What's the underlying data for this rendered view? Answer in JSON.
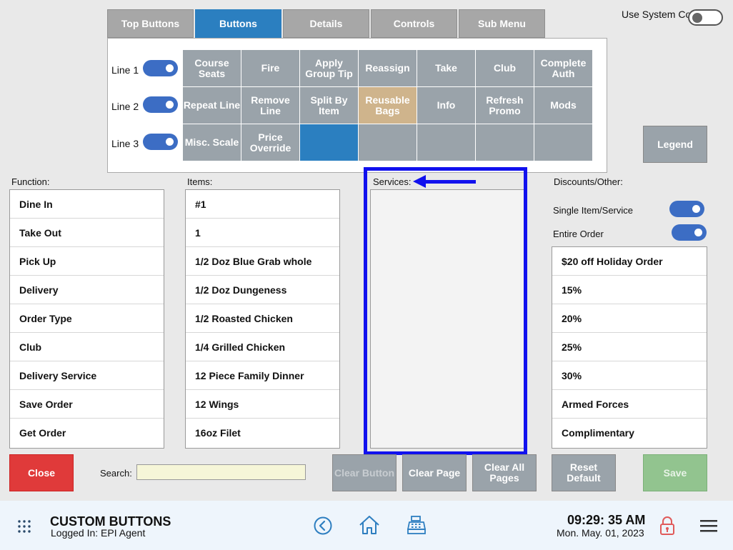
{
  "tabs": [
    "Top Buttons",
    "Buttons",
    "Details",
    "Controls",
    "Sub Menu"
  ],
  "use_system_color": "Use System Color",
  "lines": [
    "Line 1",
    "Line 2",
    "Line 3"
  ],
  "grid": [
    [
      "Course Seats",
      "Fire",
      "Apply Group Tip",
      "Reassign",
      "Take",
      "Club",
      "Complete Auth"
    ],
    [
      "Repeat Line",
      "Remove Line",
      "Split By Item",
      "Reusable Bags",
      "Info",
      "Refresh Promo",
      "Mods"
    ],
    [
      "Misc. Scale",
      "Price Override",
      "",
      "",
      "",
      "",
      ""
    ]
  ],
  "legend": "Legend",
  "labels": {
    "function": "Function:",
    "items": "Items:",
    "services": "Services:",
    "discounts": "Discounts/Other:"
  },
  "function_list": [
    "Dine In",
    "Take Out",
    "Pick Up",
    "Delivery",
    "Order Type",
    "Club",
    "Delivery Service",
    "Save Order",
    "Get Order"
  ],
  "items_list": [
    "#1",
    "1",
    "1/2 Doz Blue Grab whole",
    "1/2 Doz Dungeness",
    "1/2 Roasted Chicken",
    "1/4 Grilled Chicken",
    "12 Piece Family Dinner",
    "12 Wings",
    "16oz Filet"
  ],
  "switches": {
    "single": "Single Item/Service",
    "entire": "Entire Order"
  },
  "discounts_list": [
    "$20 off Holiday Order",
    "15%",
    "20%",
    "25%",
    "30%",
    "Armed Forces",
    "Complimentary"
  ],
  "bottom": {
    "close": "Close",
    "search_label": "Search:",
    "clear_button": "Clear Button",
    "clear_page": "Clear Page",
    "clear_all": "Clear All Pages",
    "reset_default": "Reset Default",
    "save": "Save"
  },
  "footer": {
    "title": "CUSTOM BUTTONS",
    "logged_in": "Logged In:  EPI Agent",
    "time": "09:29: 35 AM",
    "date": "Mon. May. 01, 2023"
  },
  "colors": {
    "accent": "#2b7fc0",
    "close": "#e03a3a",
    "save": "#92c48f",
    "highlight": "#1111ee"
  }
}
